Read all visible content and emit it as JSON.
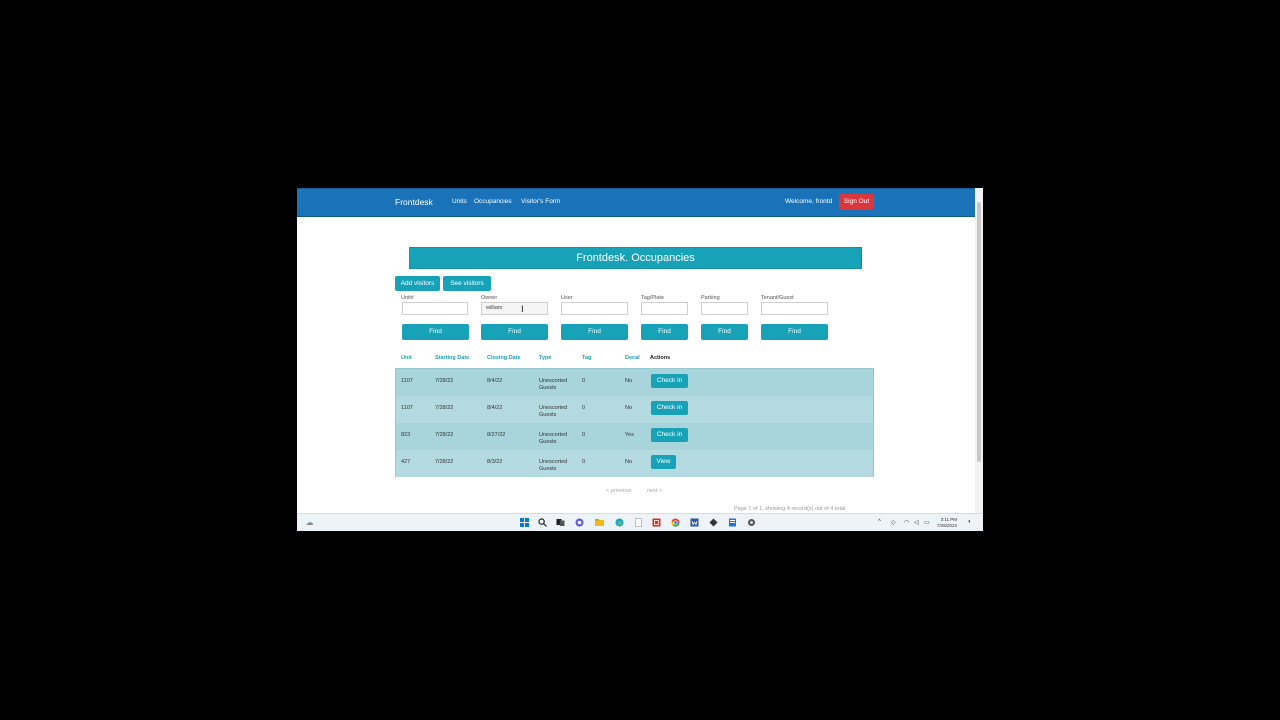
{
  "navbar": {
    "brand": "Frontdesk",
    "links": [
      "Units",
      "Occupancies",
      "Visitor's Form"
    ],
    "welcome": "Welcome, frontd",
    "signout": "Sign Out"
  },
  "page": {
    "title": "Frontdesk. Occupancies",
    "add_visitors": "Add visitors",
    "see_visitors": "See visitors"
  },
  "filters": [
    {
      "label": "Unit#",
      "value": "",
      "button": "Find"
    },
    {
      "label": "Owner",
      "value": "william",
      "button": "Find"
    },
    {
      "label": "User",
      "value": "",
      "button": "Find"
    },
    {
      "label": "Tag/Plate",
      "value": "",
      "button": "Find"
    },
    {
      "label": "Parking",
      "value": "",
      "button": "Find"
    },
    {
      "label": "Tenant/Guest",
      "value": "",
      "button": "Find"
    }
  ],
  "table": {
    "headers": [
      "Unit",
      "Starting Date",
      "Closing Date",
      "Type",
      "Tag",
      "Decal",
      "Actions"
    ],
    "rows": [
      {
        "unit": "1107",
        "start": "7/28/22",
        "close": "8/4/22",
        "type1": "Unescorted",
        "type2": "Guests",
        "tag": "0",
        "decal": "No",
        "action": "Check in"
      },
      {
        "unit": "1107",
        "start": "7/28/22",
        "close": "8/4/22",
        "type1": "Unescorted",
        "type2": "Guests",
        "tag": "0",
        "decal": "No",
        "action": "Check in"
      },
      {
        "unit": "823",
        "start": "7/28/22",
        "close": "8/27/22",
        "type1": "Unescorted",
        "type2": "Guests",
        "tag": "0",
        "decal": "Yes",
        "action": "Check in"
      },
      {
        "unit": "427",
        "start": "7/28/22",
        "close": "8/3/22",
        "type1": "Unescorted",
        "type2": "Guests",
        "tag": "0",
        "decal": "No",
        "action": "View"
      }
    ]
  },
  "pager": {
    "previous": "< previous",
    "next": "next >",
    "info": "Page 1 of 1, showing 4 record(s) out of 4 total"
  },
  "taskbar": {
    "icons": [
      "windows-start-icon",
      "search-icon",
      "task-view-icon",
      "chat-icon",
      "file-explorer-icon",
      "edge-icon",
      "notepad-icon",
      "pdf-icon",
      "chrome-icon",
      "word-icon",
      "app-icon",
      "settings-icon"
    ],
    "time": "3:11 PM",
    "date": "7/28/2022"
  },
  "colors": {
    "navbar": "#1a73b8",
    "accent": "#17a2b8",
    "danger": "#d9363e",
    "row_bg": "#a8d4dc"
  }
}
